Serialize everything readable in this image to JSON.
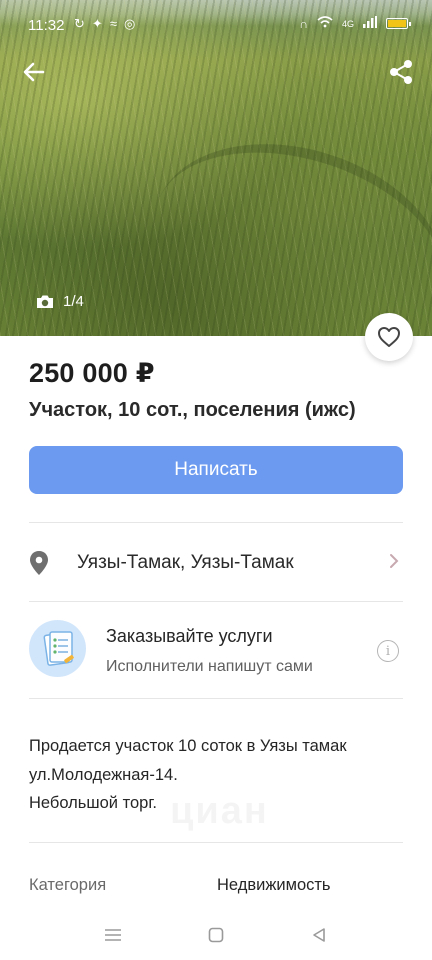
{
  "status_bar": {
    "time": "11:32",
    "left_icons": [
      "sync-icon",
      "sparkle-icon",
      "signal-wave-icon",
      "instagram-icon"
    ],
    "right_icons": [
      "headset-icon",
      "wifi-icon",
      "cell-signal-icon",
      "battery-icon"
    ],
    "network_label": "4G"
  },
  "hero": {
    "photo_counter": "1/4"
  },
  "listing": {
    "price": "250 000 ₽",
    "title": "Участок, 10 сот., поселения (ижс)",
    "write_button": "Написать",
    "location": "Уязы-Тамак, Уязы-Тамак",
    "services": {
      "title": "Заказывайте услуги",
      "subtitle": "Исполнители напишут сами"
    },
    "description": [
      "Продается участок 10 соток в Уязы тамак",
      "ул.Молодежная-14.",
      "Небольшой торг."
    ],
    "watermark": "циан",
    "details": [
      {
        "key": "Категория",
        "value": "Недвижимость"
      }
    ]
  },
  "colors": {
    "accent": "#6c9af0",
    "battery": "#f2c418",
    "services_bg": "#d2e6fb"
  }
}
